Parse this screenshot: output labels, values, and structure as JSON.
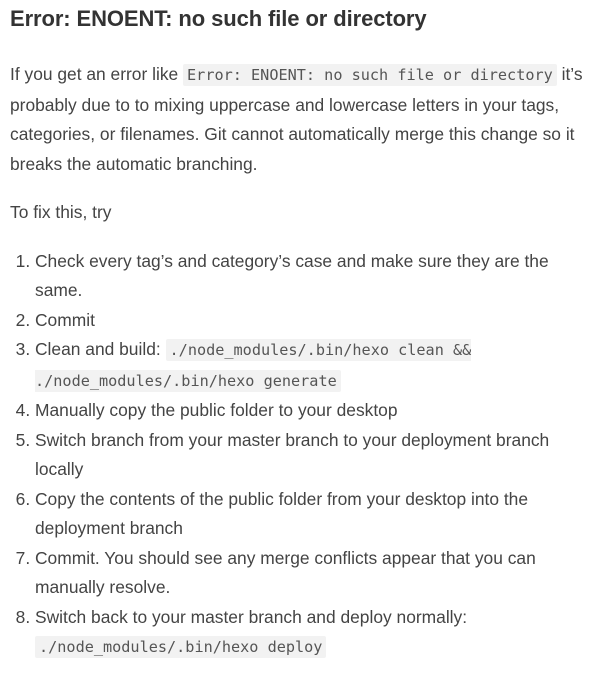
{
  "heading": "Error: ENOENT: no such file or directory",
  "intro": {
    "before": "If you get an error like ",
    "code": "Error: ENOENT: no such file or directory",
    "after": " it’s probably due to to mixing uppercase and lowercase letters in your tags, categories, or filenames. Git cannot automatically merge this change so it breaks the automatic branching."
  },
  "fix_intro": "To fix this, try",
  "steps": [
    {
      "text": "Check every tag’s and category’s case and make sure they are the same."
    },
    {
      "text": "Commit"
    },
    {
      "text": "Clean and build: ",
      "code": "./node_modules/.bin/hexo clean && ./node_modules/.bin/hexo generate"
    },
    {
      "text": "Manually copy the public folder to your desktop"
    },
    {
      "text": "Switch branch from your master branch to your deployment branch locally"
    },
    {
      "text": "Copy the contents of the public folder from your desktop into the deployment branch"
    },
    {
      "text": "Commit. You should see any merge conflicts appear that you can manually resolve."
    },
    {
      "text": "Switch back to your master branch and deploy normally: ",
      "code": "./node_modules/.bin/hexo deploy"
    }
  ]
}
